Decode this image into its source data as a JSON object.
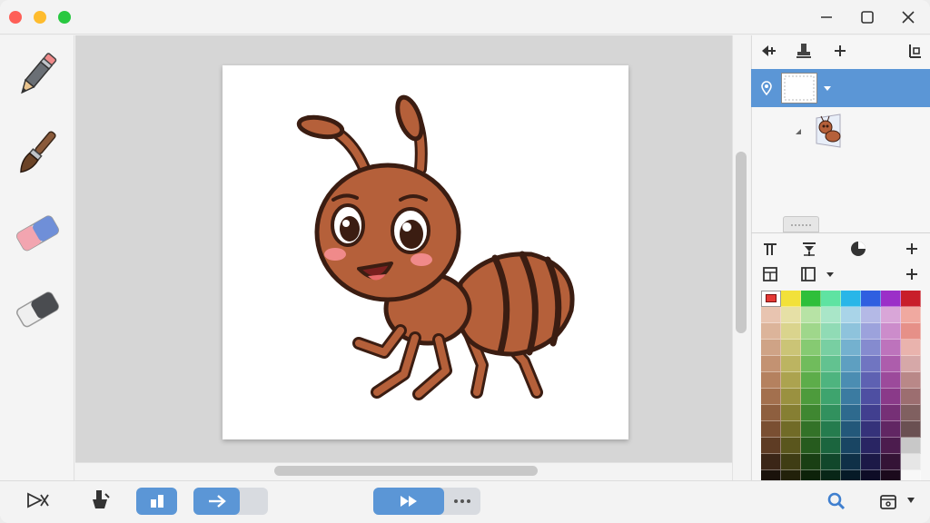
{
  "colors": {
    "accent": "#5b96d6",
    "traffic_red": "#fe5f57",
    "traffic_yellow": "#febc2e",
    "traffic_green": "#28c840",
    "ant_body": "#b5603a",
    "outline": "#3b1d12"
  },
  "titlebar": {
    "controls": [
      "minimize-icon",
      "maximize-icon",
      "close-icon"
    ]
  },
  "tools": [
    "pencil-icon",
    "brush-icon",
    "eraser-icon",
    "eraser-dark-icon"
  ],
  "layers_toolbar": [
    "layer-move-icon",
    "layer-stamp-icon",
    "add-layer-icon",
    "layer-settings-icon"
  ],
  "palette_toolbar": {
    "row1": [
      "text-tool-icon",
      "filter-icon",
      "color-wheel-icon",
      "add-icon"
    ],
    "row2": [
      "grid-icon",
      "layout-icon",
      "add-icon"
    ]
  },
  "palette": {
    "selected": "#e53935",
    "top_row": [
      "#ffffff",
      "#f2e13a",
      "#2fbf3a",
      "#5fe3a2",
      "#29b6e8",
      "#2f5fe0",
      "#9b2fc8",
      "#c81e2a"
    ],
    "columns": [
      [
        "#e8c4b0",
        "#dcb49a",
        "#cfa386",
        "#c39272",
        "#b5815f",
        "#a3704e",
        "#8e5f3f",
        "#7a4f32",
        "#5e3c24",
        "#3b2617",
        "#1a120b"
      ],
      [
        "#e6e0a6",
        "#dad48d",
        "#cbc476",
        "#bcb461",
        "#aca34f",
        "#9a9140",
        "#867f33",
        "#716b27",
        "#5a561d",
        "#3f3d14",
        "#22210a"
      ],
      [
        "#b7e3a5",
        "#9fd78b",
        "#86ca72",
        "#70bc5c",
        "#5dad4a",
        "#4d9b3c",
        "#3f8731",
        "#337228",
        "#265b1e",
        "#193f14",
        "#0d220a"
      ],
      [
        "#a9e6c8",
        "#90dbb5",
        "#78cfa2",
        "#62c290",
        "#4eb47f",
        "#3ea46e",
        "#31915e",
        "#257c4e",
        "#1b653e",
        "#11472b",
        "#082617"
      ],
      [
        "#a9d4e8",
        "#8ec3dc",
        "#74b1cf",
        "#5e9fc1",
        "#4b8db2",
        "#3b7ba1",
        "#2e6a8e",
        "#23587a",
        "#194563",
        "#0f3047",
        "#061a27"
      ],
      [
        "#b4b9e6",
        "#9ca2dc",
        "#858bcf",
        "#7075c1",
        "#5e61b2",
        "#4e4fa2",
        "#413f8f",
        "#35327a",
        "#292563",
        "#1c1947",
        "#0e0c26"
      ],
      [
        "#d9a6d8",
        "#cc8ccb",
        "#bd73bc",
        "#ad5dac",
        "#9c4a9b",
        "#8a3a89",
        "#763076",
        "#612663",
        "#4c1c4e",
        "#341336",
        "#1b0a1c"
      ],
      [
        "#f0a9a0",
        "#e69088",
        "#e9b3ad",
        "#d6a8a8",
        "#b98888",
        "#9c6e70",
        "#806060",
        "#6a5052",
        "#c8c8c8",
        "#e6e6e6",
        "#f8f8f8"
      ]
    ]
  },
  "bottombar": {
    "left_icons": [
      "crop-select-icon",
      "stamp-icon",
      "panels-icon",
      "arrow-right-icon",
      "play-forward-icon",
      "more-icon"
    ],
    "right_icons": [
      "search-icon",
      "canvas-settings-icon",
      "chevron-down-icon"
    ]
  }
}
